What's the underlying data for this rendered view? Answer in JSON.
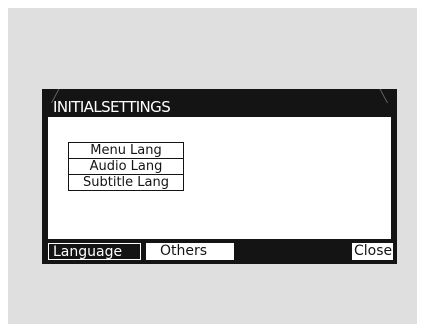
{
  "dialog": {
    "title": "INITIALSETTINGS",
    "settings_list": [
      "Menu Lang",
      "Audio Lang",
      "Subtitle Lang"
    ],
    "tabs": {
      "language": "Language",
      "others": "Others"
    },
    "close_label": "Close"
  },
  "colors": {
    "window_background": "#141414",
    "panel_background": "#dfdfdf",
    "content_background": "#ffffff"
  }
}
